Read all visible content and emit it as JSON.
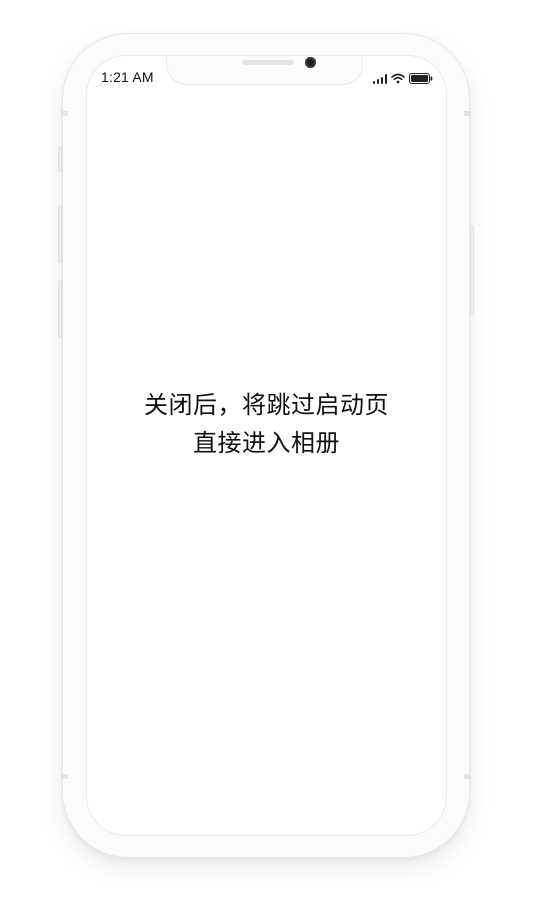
{
  "status_bar": {
    "time": "1:21 AM",
    "icons": [
      "signal-icon",
      "wifi-icon",
      "battery-icon"
    ]
  },
  "main": {
    "message_line_1": "关闭后，将跳过启动页",
    "message_line_2": "直接进入相册"
  },
  "colors": {
    "frame": "#fbfbfb",
    "screen": "#ffffff",
    "text": "#111111"
  }
}
